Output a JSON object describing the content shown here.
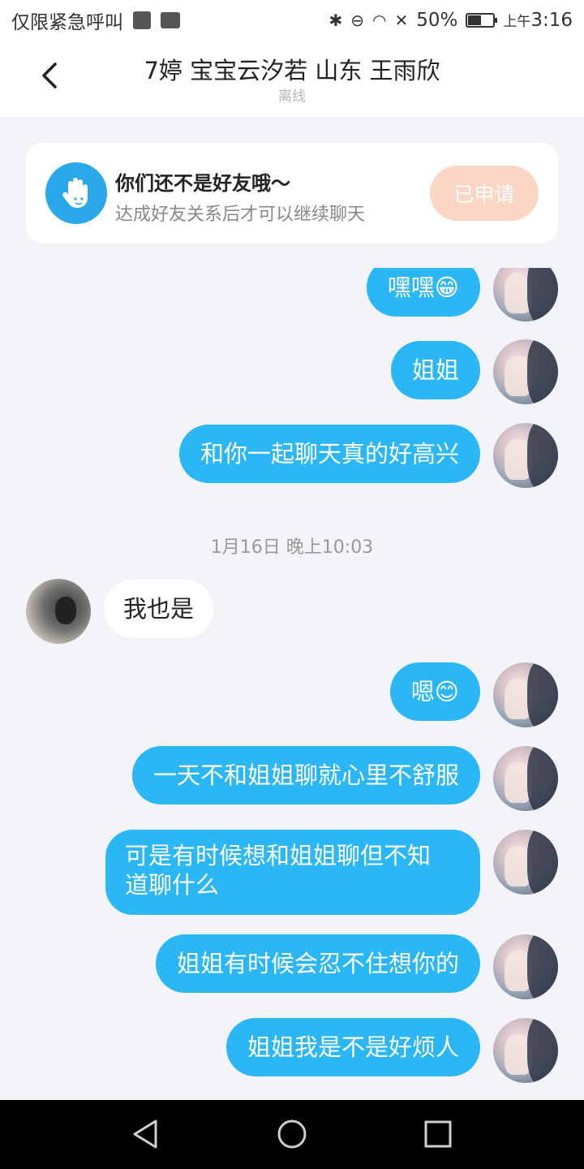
{
  "status_bar": {
    "left_text": "仅限紧急呼叫",
    "battery": "50%",
    "time_prefix": "上午",
    "time": "3:16"
  },
  "header": {
    "title": "7婷 宝宝云汐若 山东 王雨欣",
    "status": "离线"
  },
  "friend_card": {
    "title": "你们还不是好友哦～",
    "subtitle": "达成好友关系后才可以继续聊天",
    "button": "已申请"
  },
  "messages": [
    {
      "side": "right",
      "text": "嘿嘿😁"
    },
    {
      "side": "right",
      "text": "姐姐"
    },
    {
      "side": "right",
      "text": "和你一起聊天真的好高兴"
    },
    {
      "side": "right",
      "text": "我也是"
    },
    {
      "side": "right",
      "text": "嗯😊"
    },
    {
      "side": "right",
      "text": "一天不和姐姐聊就心里不舒服"
    },
    {
      "side": "right",
      "text": "可是有时候想和姐姐聊但不知"
    },
    {
      "side": "right",
      "text": "道聊什么"
    },
    {
      "side": "right",
      "text": "姐姐有时候会忍不住想你的"
    },
    {
      "side": "right",
      "text": "姐姐我是不是好烦人"
    }
  ],
  "timestamp": "1月16日 晚上10:03",
  "icons": {
    "back": "chevron-left-icon",
    "card": "hand-wave-icon",
    "nav": [
      "back-triangle-icon",
      "home-circle-icon",
      "recents-square-icon"
    ]
  },
  "colors": {
    "bubble_blue": "#2bb6f5",
    "applied_button": "#fcd6c5",
    "card_icon": "#2ba8ea"
  }
}
